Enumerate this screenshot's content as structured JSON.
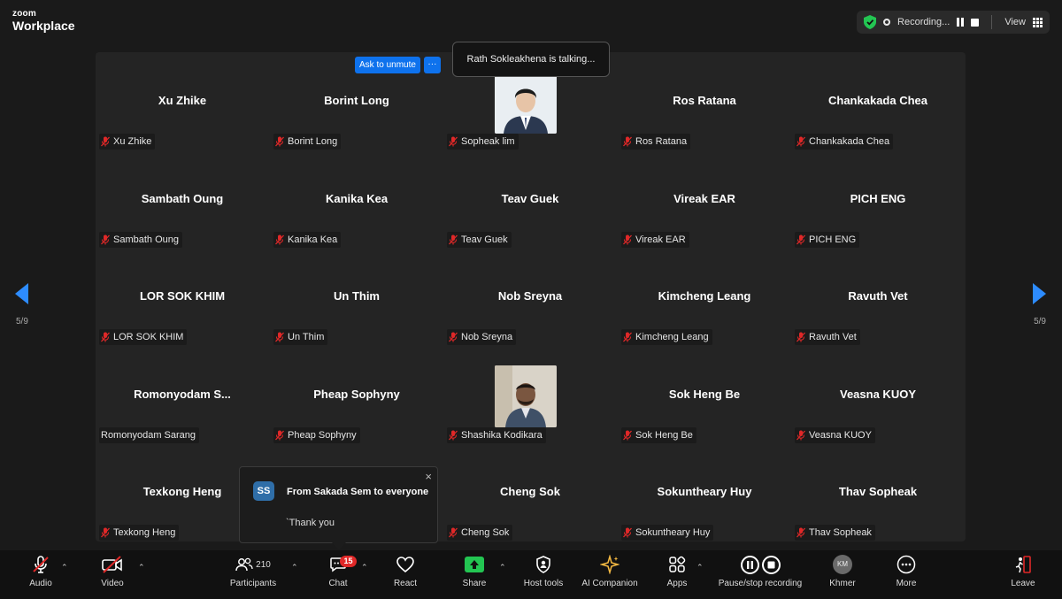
{
  "app": {
    "brand_top": "zoom",
    "brand_bottom": "Workplace"
  },
  "topbar": {
    "recording_label": "Recording...",
    "view_label": "View"
  },
  "gallery": {
    "page_indicator": "5/9",
    "unmute_label": "Ask to unmute",
    "more_label": "···",
    "talking_text": "Rath Sokleakhena is talking...",
    "participants": [
      {
        "name": "Xu Zhike",
        "tag": "Xu Zhike",
        "muted": true
      },
      {
        "name": "Borint Long",
        "tag": "Borint Long",
        "muted": true
      },
      {
        "name": "",
        "tag": "Sopheak lim",
        "muted": true,
        "photo": "man-white-shirt"
      },
      {
        "name": "Ros Ratana",
        "tag": "Ros Ratana",
        "muted": true
      },
      {
        "name": "Chankakada Chea",
        "tag": "Chankakada Chea",
        "muted": true
      },
      {
        "name": "Sambath Oung",
        "tag": "Sambath Oung",
        "muted": true
      },
      {
        "name": "Kanika Kea",
        "tag": "Kanika Kea",
        "muted": true
      },
      {
        "name": "Teav Guek",
        "tag": "Teav Guek",
        "muted": true
      },
      {
        "name": "Vireak EAR",
        "tag": "Vireak EAR",
        "muted": true
      },
      {
        "name": "PICH ENG",
        "tag": "PICH ENG",
        "muted": true
      },
      {
        "name": "LOR SOK KHIM",
        "tag": "LOR SOK KHIM",
        "muted": true
      },
      {
        "name": "Un Thim",
        "tag": "Un Thim",
        "muted": true
      },
      {
        "name": "Nob Sreyna",
        "tag": "Nob Sreyna",
        "muted": true
      },
      {
        "name": "Kimcheng Leang",
        "tag": "Kimcheng Leang",
        "muted": true
      },
      {
        "name": "Ravuth Vet",
        "tag": "Ravuth Vet",
        "muted": true
      },
      {
        "name": "Romonyodam  S...",
        "tag": "Romonyodam Sarang",
        "muted": false
      },
      {
        "name": "Pheap Sophyny",
        "tag": "Pheap Sophyny",
        "muted": true
      },
      {
        "name": "",
        "tag": "Shashika Kodikara",
        "muted": true,
        "photo": "man-suit"
      },
      {
        "name": "Sok Heng Be",
        "tag": "Sok Heng Be",
        "muted": true
      },
      {
        "name": "Veasna KUOY",
        "tag": "Veasna KUOY",
        "muted": true
      },
      {
        "name": "Texkong Heng",
        "tag": "Texkong Heng",
        "muted": true
      },
      {
        "name": "",
        "tag": "",
        "muted": false,
        "hidden": true
      },
      {
        "name": "Cheng Sok",
        "tag": "Cheng Sok",
        "muted": true
      },
      {
        "name": "Sokuntheary Huy",
        "tag": "Sokuntheary Huy",
        "muted": true
      },
      {
        "name": "Thav Sopheak",
        "tag": "Thav Sopheak",
        "muted": true
      }
    ]
  },
  "chat_popup": {
    "avatar_initials": "SS",
    "from": "From Sakada Sem to everyone",
    "message": "`Thank you",
    "close": "×"
  },
  "toolbar": {
    "audio": "Audio",
    "video": "Video",
    "participants": "Participants",
    "participants_count": "210",
    "chat": "Chat",
    "chat_badge": "15",
    "react": "React",
    "share": "Share",
    "host_tools": "Host tools",
    "ai_companion": "AI Companion",
    "apps": "Apps",
    "pause_stop_recording": "Pause/stop recording",
    "khmer": "Khmer",
    "khmer_initials": "KM",
    "more": "More",
    "leave": "Leave"
  },
  "colors": {
    "accent_blue": "#0e72ed",
    "nav_arrow": "#2d8cff",
    "muted_red": "#e02828",
    "share_green": "#23c552",
    "shield_green": "#23c552"
  }
}
